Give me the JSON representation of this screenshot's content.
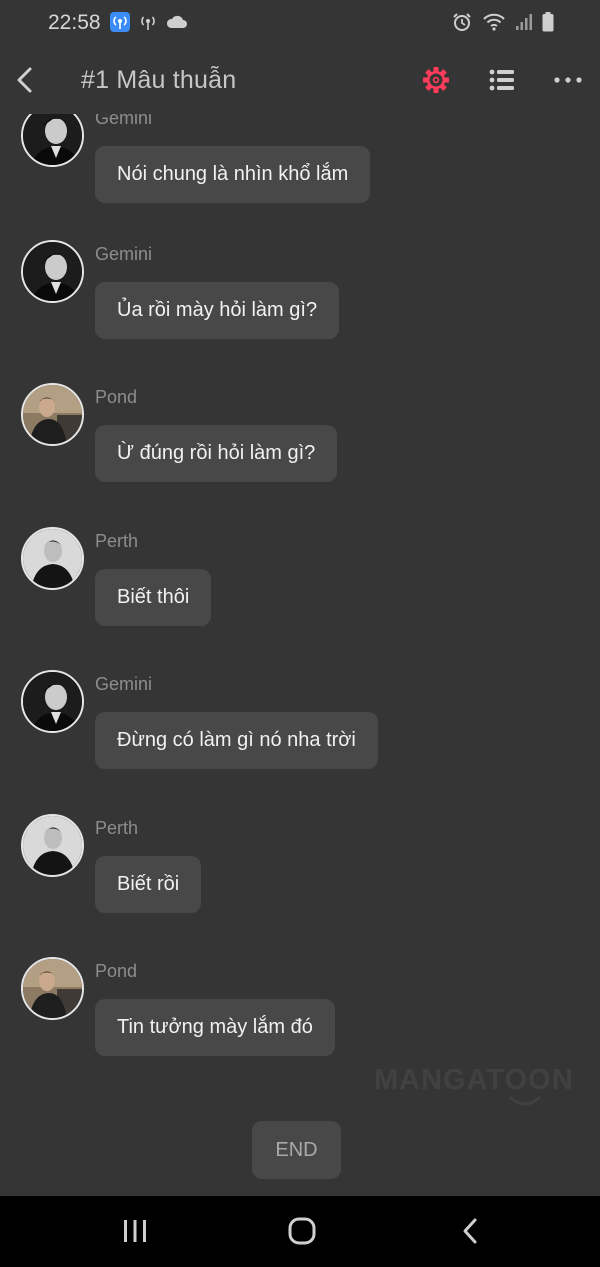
{
  "status_bar": {
    "time": "22:58",
    "left_icons": [
      "hotspot-icon",
      "signal-broadcast-icon",
      "cloud-icon"
    ],
    "right_icons": [
      "alarm-icon",
      "wifi-icon",
      "cell-signal-icon",
      "battery-icon"
    ]
  },
  "header": {
    "title": "#1 Mâu thuẫn",
    "back_icon": "chevron-left-icon",
    "settings_icon": "gear-icon",
    "settings_color": "#ff3b5c",
    "list_icon": "list-icon",
    "more_icon": "more-horizontal-icon"
  },
  "messages": [
    {
      "sender": "Gemini",
      "text": "Nói chung là nhìn khổ lắm",
      "avatar": "gemini"
    },
    {
      "sender": "Gemini",
      "text": "Ủa rồi mày hỏi làm gì?",
      "avatar": "gemini"
    },
    {
      "sender": "Pond",
      "text": "Ừ đúng rồi hỏi làm gì?",
      "avatar": "pond"
    },
    {
      "sender": "Perth",
      "text": "Biết thôi",
      "avatar": "perth"
    },
    {
      "sender": "Gemini",
      "text": "Đừng có làm gì nó nha trời",
      "avatar": "gemini"
    },
    {
      "sender": "Perth",
      "text": "Biết rồi",
      "avatar": "perth"
    },
    {
      "sender": "Pond",
      "text": "Tin tưởng mày lắm đó",
      "avatar": "pond"
    }
  ],
  "watermark": "MANGATOON",
  "end_label": "END",
  "navbar": {
    "recent_icon": "recent-apps-icon",
    "home_icon": "home-icon",
    "back_icon": "back-icon"
  },
  "colors": {
    "background": "#353535",
    "bubble": "#484848",
    "accent": "#ff3b5c"
  }
}
